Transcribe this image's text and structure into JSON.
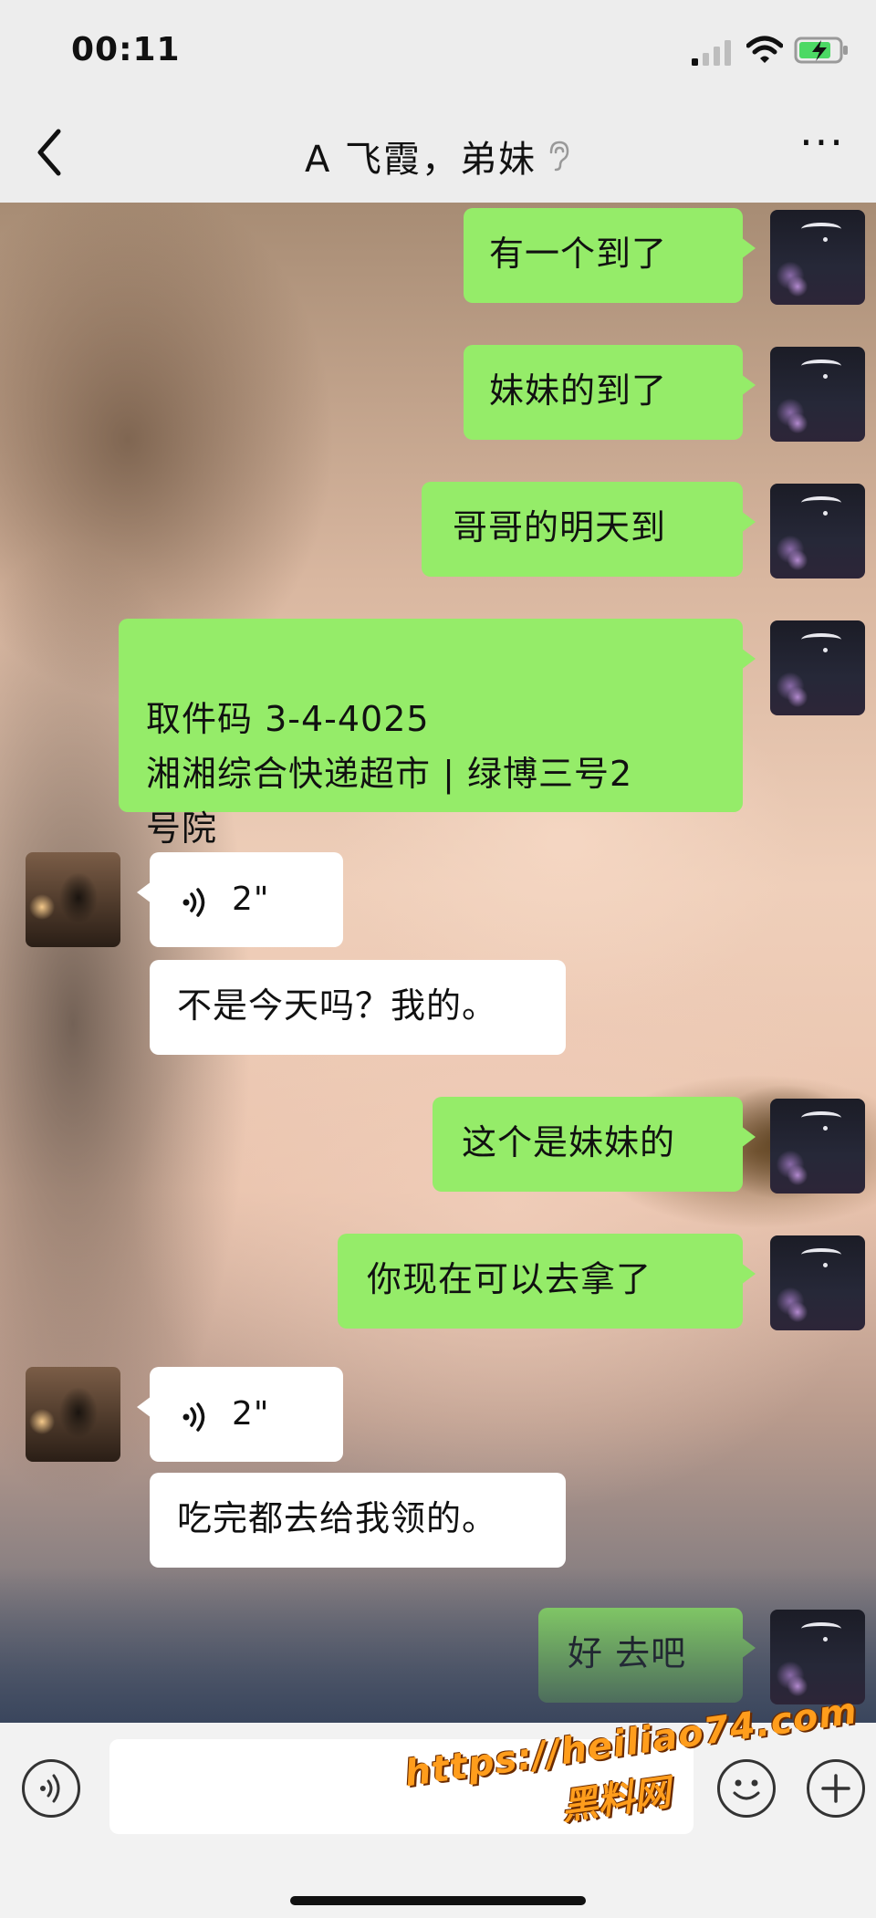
{
  "status_bar": {
    "time": "00:11",
    "icons": [
      "signal-icon",
      "wifi-icon",
      "battery-charging-icon"
    ]
  },
  "header": {
    "title": "A 飞霞，弟妹",
    "back_icon": "chevron-left-icon",
    "mute_icon": "ear-icon",
    "more_label": "···"
  },
  "messages": [
    {
      "sender": "me",
      "text": "有一个到了"
    },
    {
      "sender": "me",
      "text": "妹妹的到了"
    },
    {
      "sender": "me",
      "text": "哥哥的明天到"
    },
    {
      "sender": "me",
      "text": "取件码 3-4-4025\n湘湘综合快递超市 | 绿博三号2\n号院"
    },
    {
      "sender": "other",
      "type": "voice",
      "duration": "2\""
    },
    {
      "sender": "other",
      "text": "不是今天吗？我的。"
    },
    {
      "sender": "me",
      "text": "这个是妹妹的"
    },
    {
      "sender": "me",
      "text": "你现在可以去拿了"
    },
    {
      "sender": "other",
      "type": "voice",
      "duration": "2\""
    },
    {
      "sender": "other",
      "text": "吃完都去给我领的。"
    },
    {
      "sender": "me",
      "text": "好 去吧"
    }
  ],
  "input_bar": {
    "voice_icon": "voice-input-icon",
    "emoji_icon": "emoji-icon",
    "plus_icon": "plus-icon"
  },
  "watermark": {
    "url": "https://heiliao74.com",
    "name": "黑料网"
  },
  "colors": {
    "me_bubble": "#95ec69",
    "other_bubble": "#ffffff",
    "chrome": "#ededed"
  }
}
